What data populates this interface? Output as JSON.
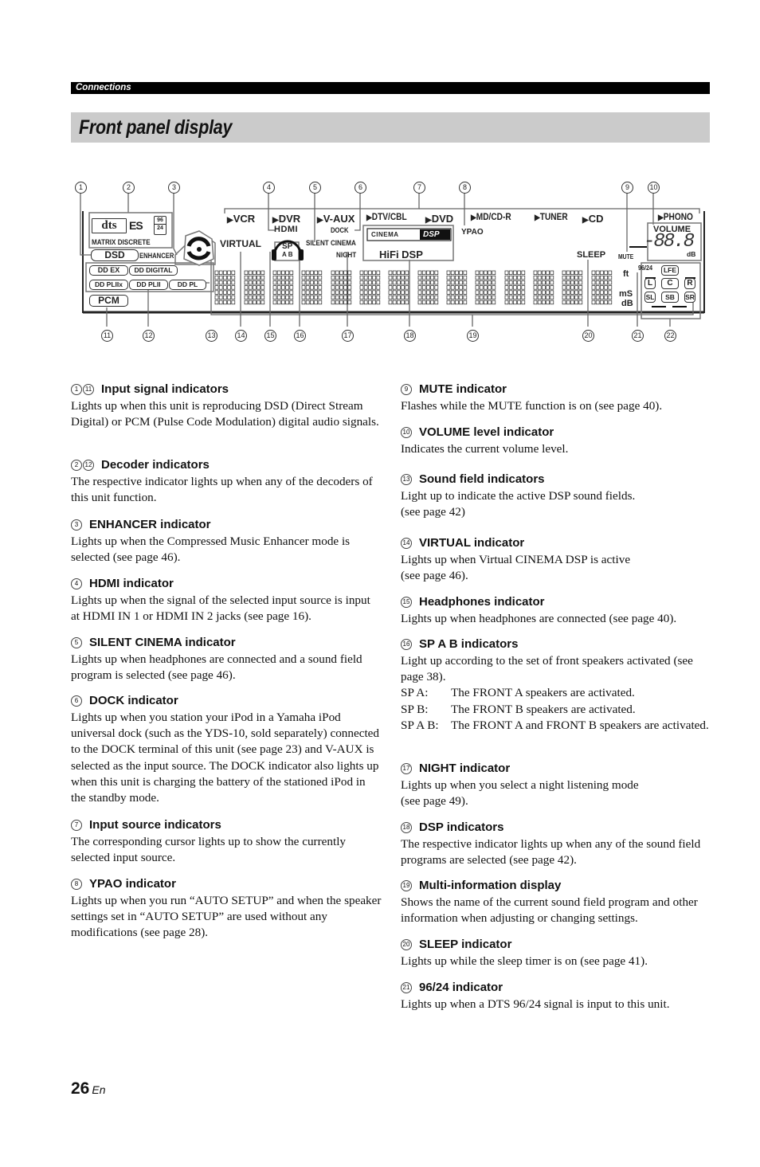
{
  "header": {
    "section": "Connections",
    "title": "Front panel display"
  },
  "diagram": {
    "callouts_top": [
      "1",
      "2",
      "3",
      "4",
      "5",
      "6",
      "7",
      "8",
      "9",
      "10"
    ],
    "callouts_bottom": [
      "11",
      "12",
      "13",
      "14",
      "15",
      "16",
      "17",
      "18",
      "19",
      "20",
      "21",
      "22"
    ],
    "dts_logo": "dts",
    "es_logo": "ES",
    "dts_96": "96",
    "dts_24": "24",
    "matrix_discrete": "MATRIX DISCRETE",
    "dsd": "DSD",
    "enhancer": "ENHANCER",
    "decoders": [
      "DD EX",
      "DD DIGITAL",
      "DD PLIIx",
      "DD PLII",
      "DD PL"
    ],
    "pcm": "PCM",
    "virtual": "VIRTUAL",
    "hdmi": "HDMI",
    "sp": "SP",
    "ab": "A B",
    "silent_cinema": "SILENT CINEMA",
    "dock": "DOCK",
    "night": "NIGHT",
    "inputs": [
      "VCR",
      "DVR",
      "V-AUX",
      "DTV/CBL",
      "DVD",
      "MD/CD-R",
      "TUNER",
      "CD",
      "PHONO"
    ],
    "cinema": "CINEMA",
    "dsp": "DSP",
    "hifi_dsp": "HiFi DSP",
    "ypao": "YPAO",
    "sleep": "SLEEP",
    "mute": "MUTE",
    "volume": "VOLUME",
    "volume_digits": "-88.8",
    "db": "dB",
    "ft": "ft",
    "ms": "mS",
    "db2": "dB",
    "r9624": "96/24",
    "speakers": [
      "LFE",
      "L",
      "C",
      "R",
      "SL",
      "SB",
      "SR"
    ]
  },
  "left_column": [
    {
      "nums": [
        "1",
        "11"
      ],
      "title": "Input signal indicators",
      "text": "Lights up when this unit is reproducing DSD (Direct Stream Digital) or PCM (Pulse Code Modulation) digital audio signals."
    },
    {
      "nums": [
        "2",
        "12"
      ],
      "title": "Decoder indicators",
      "text": "The respective indicator lights up when any of the decoders of this unit function."
    },
    {
      "nums": [
        "3"
      ],
      "title": "ENHANCER indicator",
      "text": "Lights up when the Compressed Music Enhancer mode is selected (see page 46)."
    },
    {
      "nums": [
        "4"
      ],
      "title": "HDMI indicator",
      "text": "Lights up when the signal of the selected input source is input at HDMI IN 1 or HDMI IN 2 jacks (see page 16)."
    },
    {
      "nums": [
        "5"
      ],
      "title": "SILENT CINEMA indicator",
      "text": "Lights up when headphones are connected and a sound field program is selected (see page 46)."
    },
    {
      "nums": [
        "6"
      ],
      "title": "DOCK indicator",
      "text": "Lights up when you station your iPod in a Yamaha iPod universal dock (such as the YDS-10, sold separately) connected to the DOCK terminal of this unit (see page 23) and V-AUX is selected as the input source. The DOCK indicator also lights up when this unit is charging the battery of the stationed iPod in the standby mode."
    },
    {
      "nums": [
        "7"
      ],
      "title": "Input source indicators",
      "text": "The corresponding cursor lights up to show the currently selected input source."
    },
    {
      "nums": [
        "8"
      ],
      "title": "YPAO indicator",
      "text": "Lights up when you run “AUTO SETUP” and when the speaker settings set in “AUTO SETUP” are used without any modifications (see page 28)."
    }
  ],
  "right_column": [
    {
      "nums": [
        "9"
      ],
      "title": "MUTE indicator",
      "text": "Flashes while the MUTE function is on (see page 40)."
    },
    {
      "nums": [
        "10"
      ],
      "title": "VOLUME level indicator",
      "text": "Indicates the current volume level."
    },
    {
      "nums": [
        "13"
      ],
      "title": "Sound field indicators",
      "text": "Light up to indicate the active DSP sound fields.\n(see page 42)"
    },
    {
      "nums": [
        "14"
      ],
      "title": "VIRTUAL indicator",
      "text": "Lights up when Virtual CINEMA DSP is active\n(see page 46)."
    },
    {
      "nums": [
        "15"
      ],
      "title": "Headphones indicator",
      "text": "Lights up when headphones are connected (see page 40)."
    },
    {
      "nums": [
        "16"
      ],
      "title": "SP A B indicators",
      "text": "Light up according to the set of front speakers activated (see page 38).",
      "rows": [
        {
          "k": "SP A:",
          "v": "The FRONT A speakers are activated."
        },
        {
          "k": "SP B:",
          "v": "The FRONT B speakers are activated."
        },
        {
          "k": "SP A B:",
          "v": "The FRONT A and FRONT B speakers are activated."
        }
      ]
    },
    {
      "nums": [
        "17"
      ],
      "title": "NIGHT indicator",
      "text": "Lights up when you select a night listening mode\n(see page 49)."
    },
    {
      "nums": [
        "18"
      ],
      "title": "DSP indicators",
      "text": "The respective indicator lights up when any of the sound field programs are selected (see page 42)."
    },
    {
      "nums": [
        "19"
      ],
      "title": "Multi-information display",
      "text": "Shows the name of the current sound field program and other information when adjusting or changing settings."
    },
    {
      "nums": [
        "20"
      ],
      "title": "SLEEP indicator",
      "text": "Lights up while the sleep timer is on (see page 41)."
    },
    {
      "nums": [
        "21"
      ],
      "title": "96/24 indicator",
      "text": "Lights up when a DTS 96/24 signal is input to this unit."
    }
  ],
  "footer": {
    "page": "26",
    "lang": "En"
  }
}
